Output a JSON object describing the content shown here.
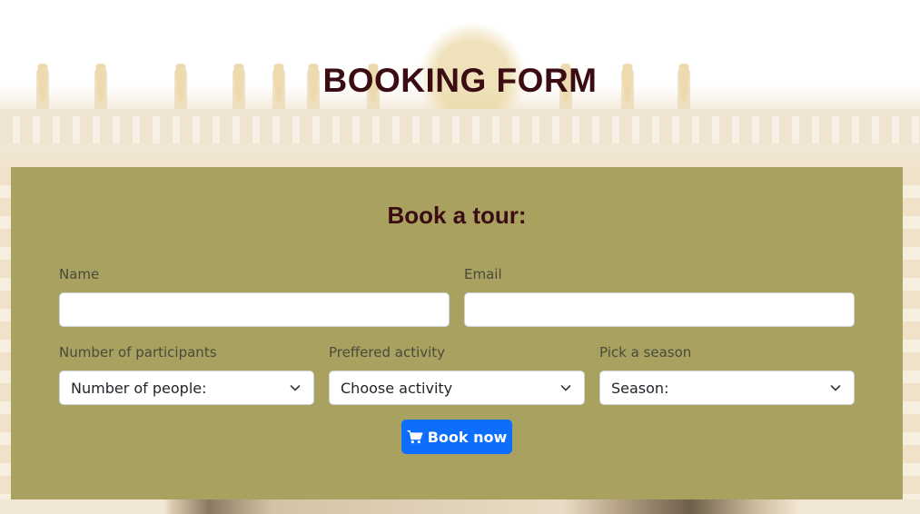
{
  "page": {
    "title": "BOOKING FORM"
  },
  "form": {
    "heading": "Book a tour:",
    "name_label": "Name",
    "email_label": "Email",
    "participants_label": "Number of participants",
    "participants_selected": "Number of people:",
    "activity_label": "Preffered activity",
    "activity_selected": "Choose activity",
    "season_label": "Pick a season",
    "season_selected": "Season:",
    "submit_label": "Book now"
  },
  "icons": {
    "submit": "cart-icon",
    "select": "chevron-down-icon"
  },
  "colors": {
    "title": "#3b0d12",
    "panel": "#a9a160",
    "button": "#0d6efd"
  }
}
